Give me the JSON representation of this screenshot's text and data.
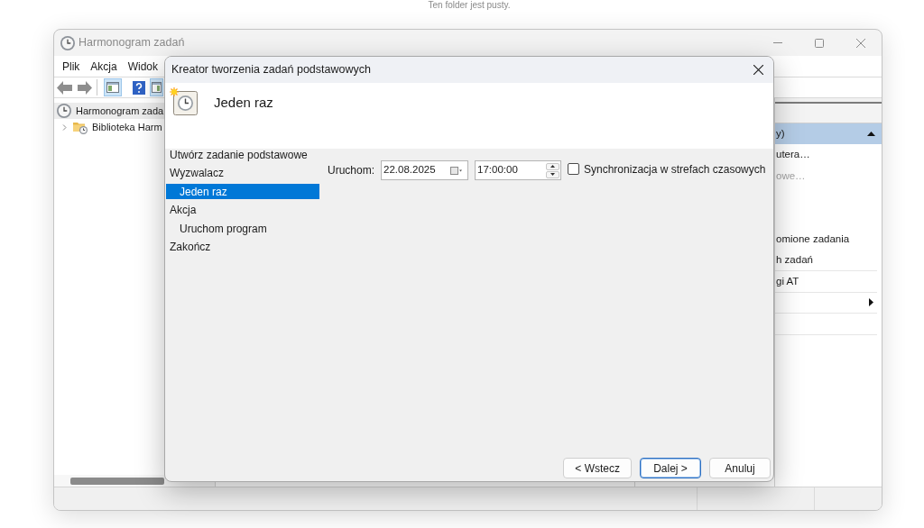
{
  "background_text": "Ten folder jest pusty.",
  "main_window": {
    "title": "Harmonogram zadań",
    "active": false,
    "menu": [
      "Plik",
      "Akcja",
      "Widok"
    ],
    "toolbar": [
      {
        "kind": "back"
      },
      {
        "kind": "forward"
      },
      {
        "kind": "separator"
      },
      {
        "kind": "tree",
        "pressed": true
      },
      {
        "kind": "help",
        "pressed": false
      },
      {
        "kind": "pane",
        "pressed": true
      }
    ],
    "tree": [
      {
        "label": "Harmonogram zada",
        "selected": true,
        "children": [
          {
            "label": "Biblioteka Harm",
            "selected": false,
            "expanded": false
          }
        ]
      }
    ],
    "actions": {
      "header": "y)",
      "expanded": true,
      "items": [
        {
          "kind": "action",
          "label": "utera…",
          "disabled": false
        },
        {
          "kind": "action",
          "label": "owe…",
          "disabled": true
        },
        {
          "kind": "hidden"
        },
        {
          "kind": "hidden"
        },
        {
          "kind": "action",
          "label": "omione zadania",
          "disabled": false
        }
      ],
      "separated_items": [
        {
          "kind": "action",
          "label": "h zadań",
          "disabled": false
        },
        {
          "kind": "action",
          "label": "gi AT",
          "disabled": false
        },
        {
          "kind": "submenu"
        },
        {
          "kind": "hidden"
        }
      ]
    }
  },
  "dialog": {
    "title": "Kreator tworzenia zadań podstawowych",
    "heading": "Jeden raz",
    "steps": [
      {
        "label": "Utwórz zadanie podstawowe",
        "selected": false
      },
      {
        "label": "Wyzwalacz",
        "selected": false,
        "children": [
          {
            "label": "Jeden raz",
            "selected": true
          }
        ]
      },
      {
        "label": "Akcja",
        "selected": false,
        "children": [
          {
            "label": "Uruchom program",
            "selected": false
          }
        ]
      },
      {
        "label": "Zakończ",
        "selected": false
      }
    ],
    "start": {
      "label": "Uruchom:",
      "date": "22.08.2025",
      "time": "17:00:00"
    },
    "sync": {
      "label": "Synchronizacja w strefach czasowych",
      "checked": false
    },
    "buttons": [
      {
        "label": "< Wstecz",
        "default": false
      },
      {
        "label": "Dalej >",
        "default": true
      },
      {
        "label": "Anuluj",
        "default": false
      }
    ]
  }
}
